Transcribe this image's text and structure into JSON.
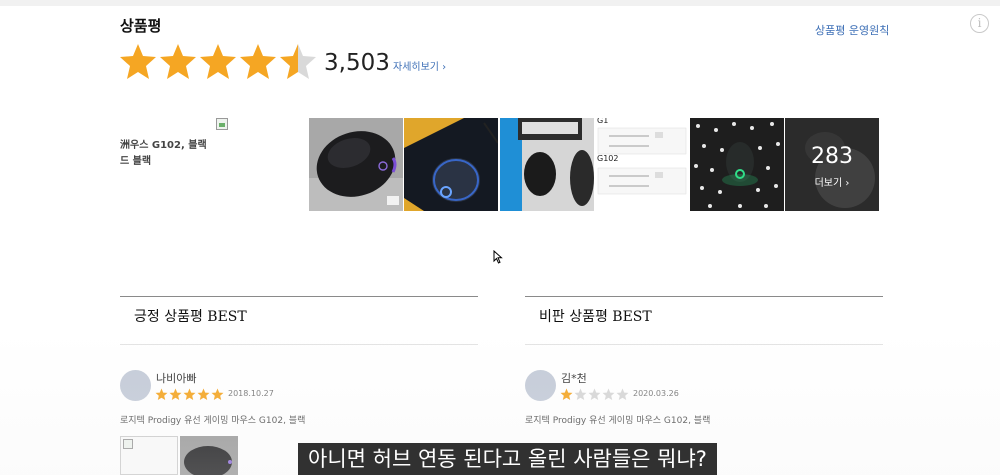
{
  "header": {
    "section_title": "상품평",
    "policy_link": "상품평 운영원칙",
    "info_icon": "i"
  },
  "rating": {
    "stars": 4.5,
    "star_color": "#f5a623",
    "count": "3,503",
    "detail_link": "자세히보기 ›"
  },
  "gallery": {
    "broken_alt_line1": "洲우스 G102, 블랙",
    "broken_alt_line2": "드 블랙",
    "more_count": "283",
    "more_label": "더보기 ›",
    "screenshot_label_1": "G1",
    "screenshot_label_2": "G102"
  },
  "positive_best": {
    "title": "긍정 상품평 BEST",
    "reviewer": "나비아빠",
    "stars": 5,
    "date": "2018.10.27",
    "product": "로지텍 Prodigy 유선 게이밍 마우스 G102, 블랙"
  },
  "negative_best": {
    "title": "비판 상품평 BEST",
    "reviewer": "김*천",
    "stars": 1,
    "date": "2020.03.26",
    "product": "로지텍 Prodigy 유선 게이밍 마우스 G102, 블랙"
  },
  "subtitle": "아니면 허브 연동 된다고 올린 사람들은 뭐냐?"
}
